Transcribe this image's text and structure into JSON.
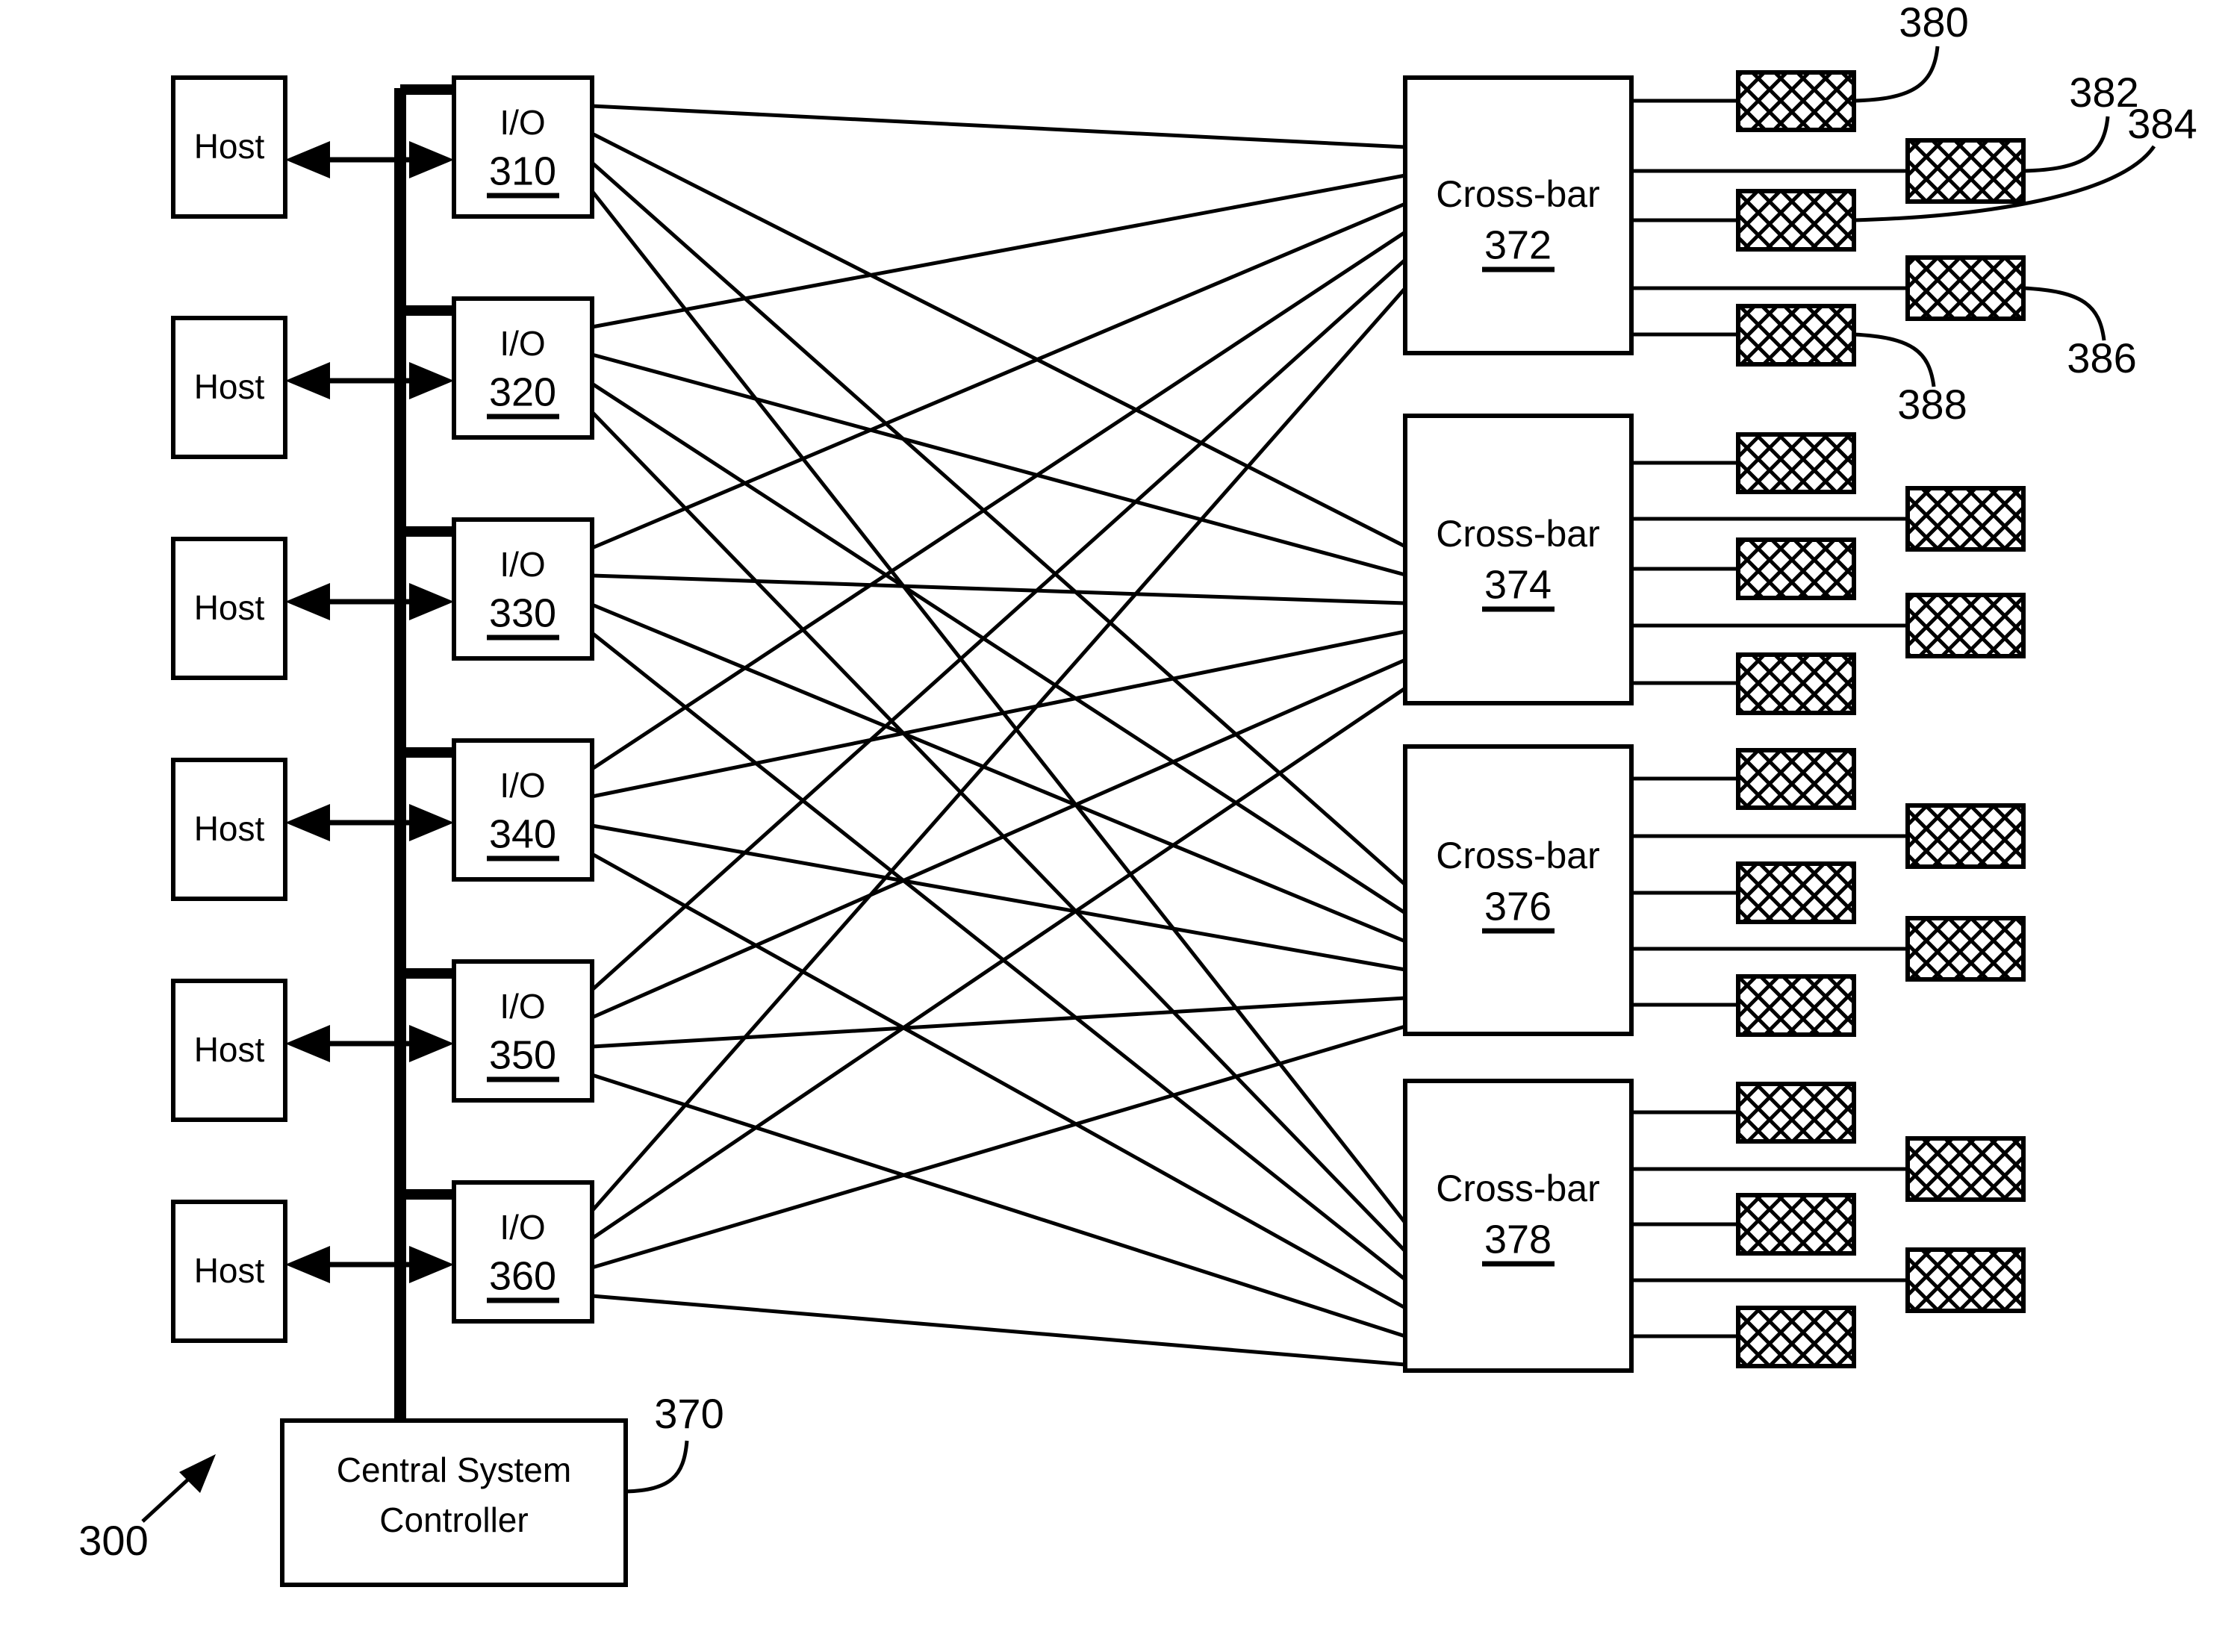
{
  "figure": {
    "figure_ref": "300",
    "background_color": "#ffffff",
    "line_color": "#000000"
  },
  "hosts": [
    {
      "label": "Host"
    },
    {
      "label": "Host"
    },
    {
      "label": "Host"
    },
    {
      "label": "Host"
    },
    {
      "label": "Host"
    },
    {
      "label": "Host"
    }
  ],
  "io_modules": [
    {
      "label": "I/O",
      "ref": "310"
    },
    {
      "label": "I/O",
      "ref": "320"
    },
    {
      "label": "I/O",
      "ref": "330"
    },
    {
      "label": "I/O",
      "ref": "340"
    },
    {
      "label": "I/O",
      "ref": "350"
    },
    {
      "label": "I/O",
      "ref": "360"
    }
  ],
  "crossbars": [
    {
      "label": "Cross-bar",
      "ref": "372"
    },
    {
      "label": "Cross-bar",
      "ref": "374"
    },
    {
      "label": "Cross-bar",
      "ref": "376"
    },
    {
      "label": "Cross-bar",
      "ref": "378"
    }
  ],
  "controller": {
    "line1": "Central System",
    "line2": "Controller",
    "ref": "370"
  },
  "storage_refs": {
    "r380": "380",
    "r382": "382",
    "r384": "384",
    "r386": "386",
    "r388": "388"
  }
}
